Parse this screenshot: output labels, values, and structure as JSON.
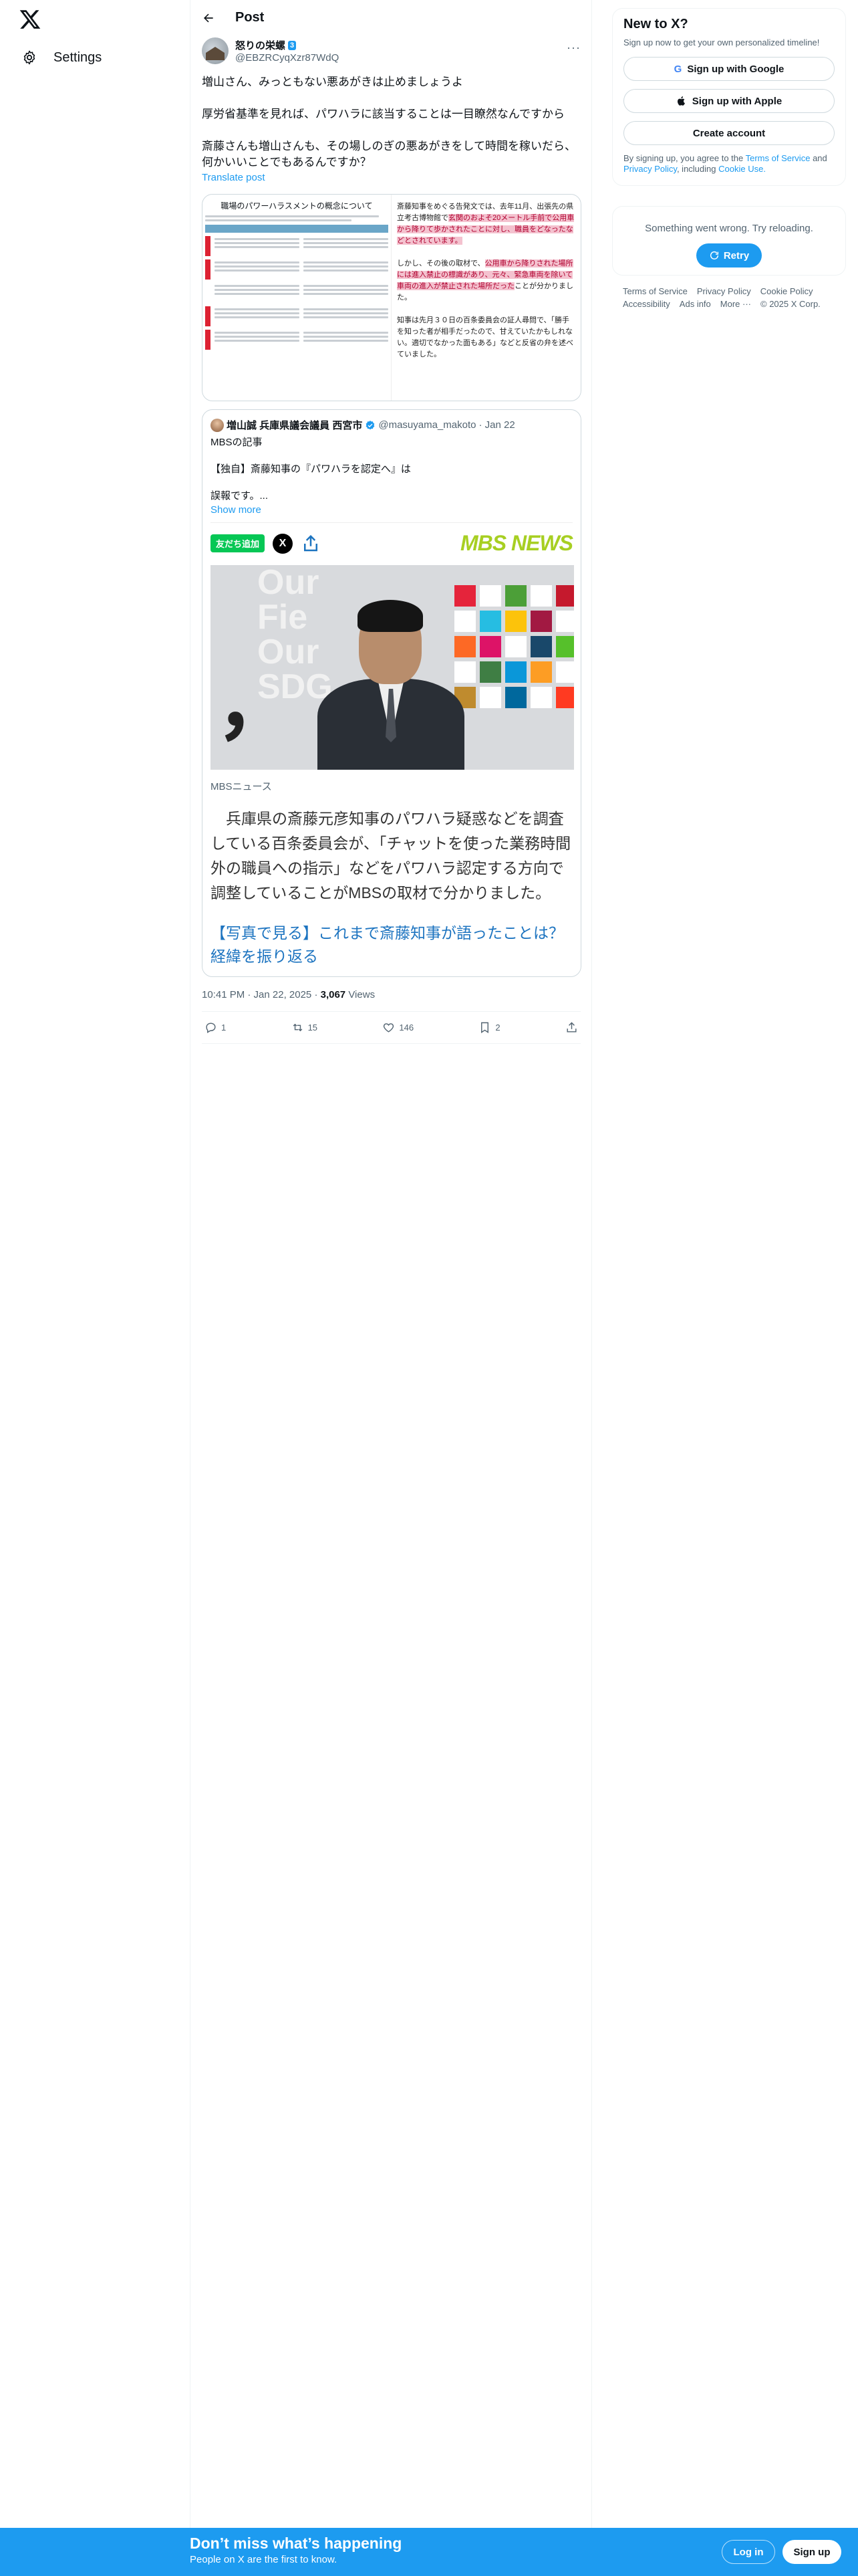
{
  "nav": {
    "settings_label": "Settings"
  },
  "header": {
    "title": "Post"
  },
  "tweet": {
    "display_name": "怒りの栄螺",
    "badge": "3",
    "handle": "@EBZRCyqXzr87WdQ",
    "text": "増山さん、みっともない悪あがきは止めましょうよ\n\n厚労省基準を見れば、パワハラに該当することは一目瞭然なんですから\n\n斎藤さんも増山さんも、その場しのぎの悪あがきをして時間を稼いだら、何かいいことでもあるんですか？",
    "translate": "Translate post",
    "doc_image": {
      "title": "職場のパワーハラスメントの概念について",
      "right_text": "斎藤知事をめぐる告発文では、去年11月、出張先の県立考古博物館で",
      "right_highlight": "玄関のおよそ20メートル手前で公用車から降りて歩かされたことに対し、職員をどなったなどとされています。",
      "right_text2": "しかし、その後の取材で、",
      "right_highlight2": "公用車から降りされた場所には進入禁止の標識があり、元々、緊急車両を除いて車両の進入が禁止された場所だった",
      "right_text3": "ことが分かりました。",
      "right_text4": "知事は先月３０日の百条委員会の証人尋問で、「勝手を知った者が相手だったので、甘えていたかもしれない。適切でなかった面もある」などと反省の弁を述べていました。"
    },
    "quote": {
      "name": "増山誠 兵庫県議会議員 西宮市",
      "handle": "@masuyama_makoto",
      "date": "· Jan 22",
      "text": "MBSの記事\n\n【独自】斎藤知事の『パワハラを認定へ』は\n\n誤報です。...",
      "show_more": "Show more",
      "line_button": "友だち追加",
      "x_glyph": "X",
      "mbs_logo": "MBS NEWS",
      "photo_text": "Our\nFie\nOur\nSDG",
      "photo_bigchar": "，",
      "source": "MBSニュース",
      "lead": "　兵庫県の斎藤元彦知事のパワハラ疑惑などを調査している百条委員会が、「チャットを使った業務時間外の職員への指示」などをパワハラ認定する方向で調整していることがMBSの取材で分かりました。",
      "link": "【写真で見る】これまで斎藤知事が語ったことは？経緯を振り返る"
    },
    "time": "10:41 PM · Jan 22, 2025 ·",
    "views_count": "3,067",
    "views_label": "Views",
    "actions": {
      "replies": "1",
      "reposts": "15",
      "likes": "146",
      "bookmarks": "2"
    }
  },
  "sidebar": {
    "new_title": "New to X?",
    "new_sub": "Sign up now to get your own personalized timeline!",
    "google_label": "Sign up with Google",
    "apple_label": "Sign up with Apple",
    "create_label": "Create account",
    "legal_prefix": "By signing up, you agree to the",
    "terms": "Terms of Service",
    "and": "and",
    "privacy": "Privacy Policy",
    "including": ", including",
    "cookie": "Cookie Use.",
    "error_text": "Something went wrong. Try reloading.",
    "retry_label": "Retry",
    "footer": [
      "Terms of Service",
      "Privacy Policy",
      "Cookie Policy",
      "Accessibility",
      "Ads info",
      "More ···",
      "© 2025 X Corp."
    ]
  },
  "bottom_bar": {
    "title": "Don’t miss what’s happening",
    "subtitle": "People on X are the first to know.",
    "login": "Log in",
    "signup": "Sign up"
  },
  "colors": {
    "accent": "#1d9bf0",
    "line_green": "#06c755",
    "mbs_green": "#a7cf22"
  }
}
